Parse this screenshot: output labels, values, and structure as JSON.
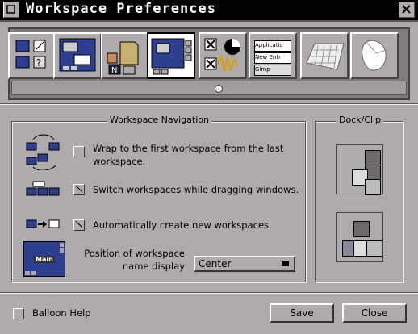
{
  "window": {
    "title": "Workspace Preferences"
  },
  "icon_strip": {
    "items": [
      {
        "id": "window-handling"
      },
      {
        "id": "window-focus"
      },
      {
        "id": "menu-preferences"
      },
      {
        "id": "workspace-preferences",
        "selected": true
      },
      {
        "id": "other-preferences"
      },
      {
        "id": "application-paths",
        "texts": [
          "Applicatio",
          "New Entr",
          "Gimp"
        ]
      },
      {
        "id": "keyboard-shortcuts"
      },
      {
        "id": "mouse-preferences"
      }
    ]
  },
  "workspace_navigation": {
    "title": "Workspace Navigation",
    "options": [
      {
        "label": "Wrap to the first workspace from the last workspace.",
        "checked": false
      },
      {
        "label": "Switch workspaces while dragging windows.",
        "checked": true
      },
      {
        "label": "Automatically create new workspaces.",
        "checked": true
      }
    ],
    "position_label": "Position of workspace name display",
    "position_value": "Center",
    "preview_text": "Main"
  },
  "dock_clip": {
    "title": "Dock/Clip"
  },
  "footer": {
    "balloon_help_label": "Balloon Help",
    "balloon_help_checked": false,
    "save_label": "Save",
    "close_label": "Close"
  }
}
